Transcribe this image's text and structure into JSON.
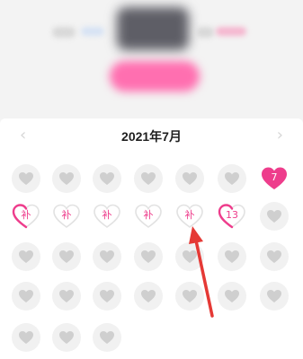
{
  "calendar": {
    "month_title": "2021年7月",
    "prev_symbol": "‹",
    "next_symbol": "›",
    "colors": {
      "pink": "#ee3d8c",
      "empty_heart": "#cfcfcf",
      "circle_bg": "#f1f1f1",
      "arrow": "#e53935"
    },
    "rows": [
      [
        {
          "type": "empty"
        },
        {
          "type": "empty"
        },
        {
          "type": "empty"
        },
        {
          "type": "empty"
        },
        {
          "type": "empty"
        },
        {
          "type": "empty"
        },
        {
          "type": "filled",
          "label": "7"
        }
      ],
      [
        {
          "type": "makeup",
          "label": "补",
          "accent": "left"
        },
        {
          "type": "makeup",
          "label": "补"
        },
        {
          "type": "makeup",
          "label": "补"
        },
        {
          "type": "makeup",
          "label": "补"
        },
        {
          "type": "makeup",
          "label": "补"
        },
        {
          "type": "today",
          "label": "13",
          "accent": "left"
        },
        {
          "type": "empty"
        }
      ],
      [
        {
          "type": "empty"
        },
        {
          "type": "empty"
        },
        {
          "type": "empty"
        },
        {
          "type": "empty"
        },
        {
          "type": "empty"
        },
        {
          "type": "empty"
        },
        {
          "type": "empty"
        }
      ],
      [
        {
          "type": "empty"
        },
        {
          "type": "empty"
        },
        {
          "type": "empty"
        },
        {
          "type": "empty"
        },
        {
          "type": "empty"
        },
        {
          "type": "empty"
        },
        {
          "type": "empty"
        }
      ],
      [
        {
          "type": "empty"
        },
        {
          "type": "empty"
        },
        {
          "type": "empty"
        }
      ]
    ]
  }
}
